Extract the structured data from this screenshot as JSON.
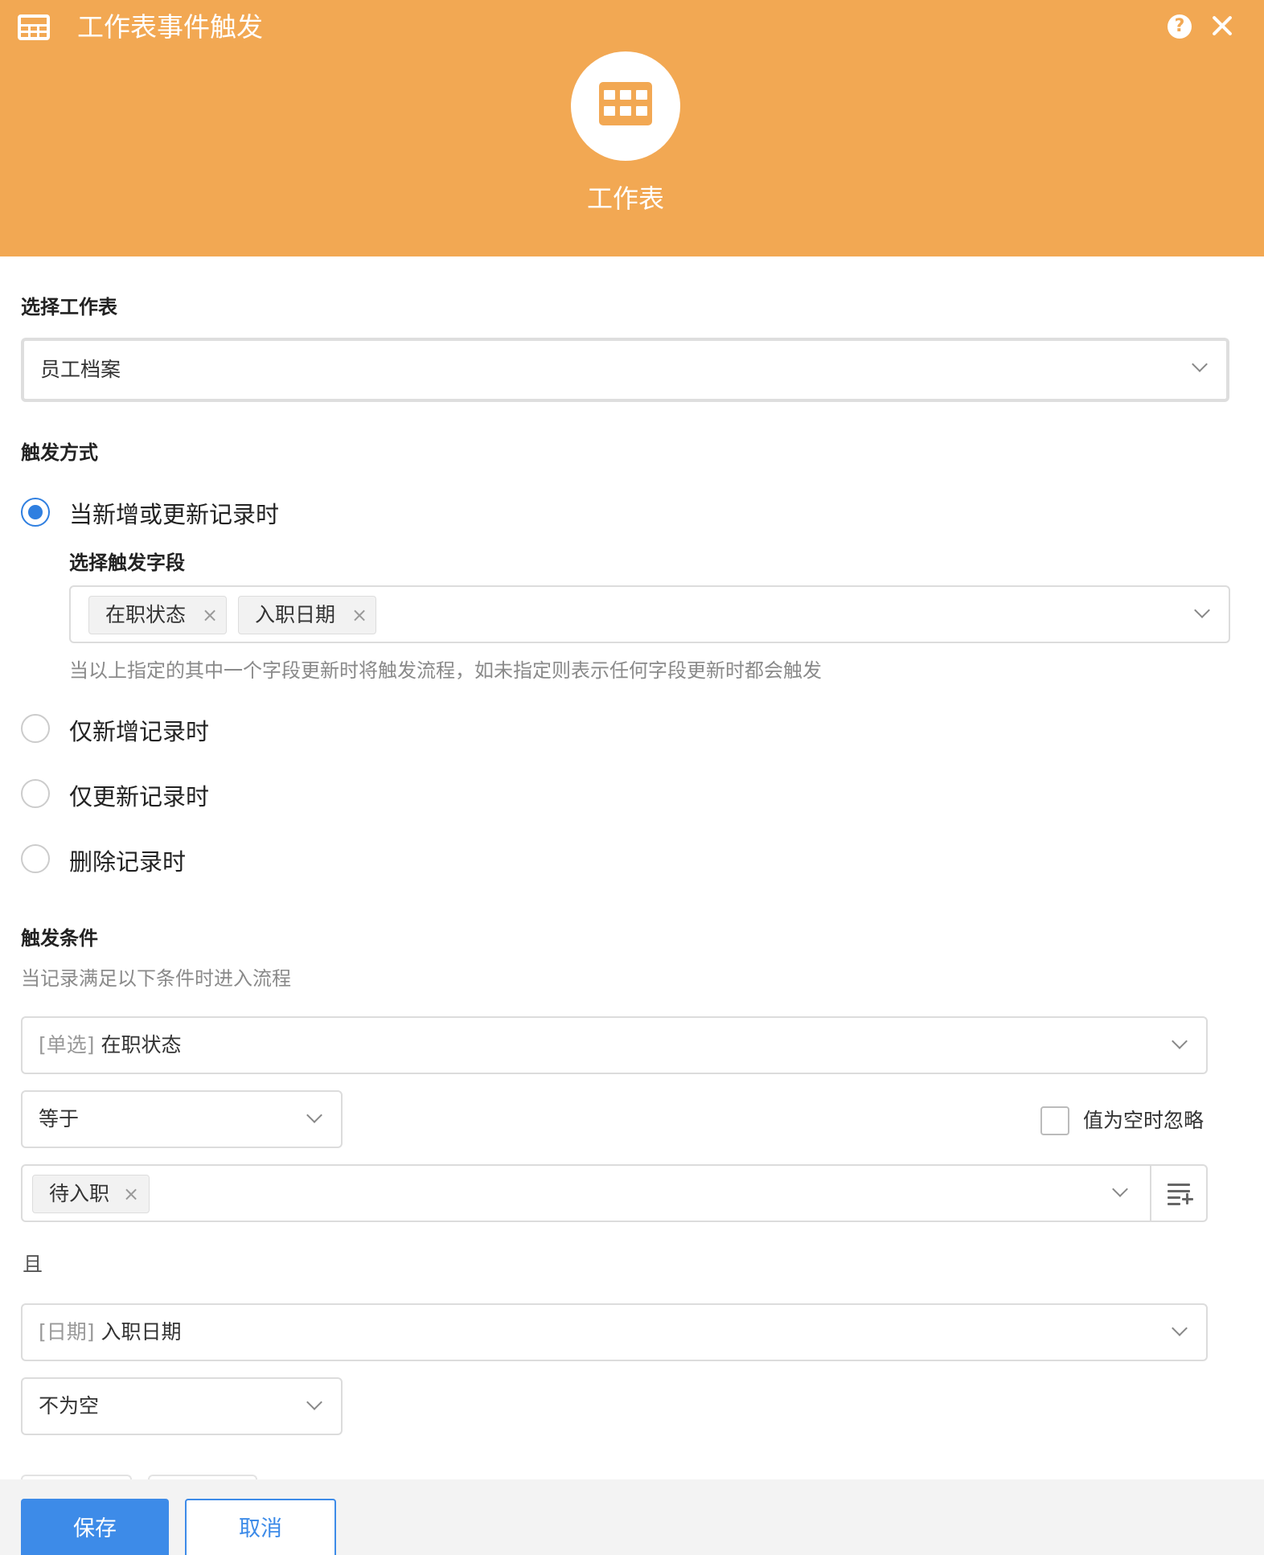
{
  "header": {
    "title": "工作表事件触发",
    "icon": "grid-table-icon",
    "help_symbol": "?",
    "center_label": "工作表",
    "accent_color": "#f2a853"
  },
  "sheet_section": {
    "label": "选择工作表",
    "selected_sheet": "员工档案"
  },
  "trigger_section": {
    "label": "触发方式",
    "options": [
      {
        "label": "当新增或更新记录时",
        "checked": true
      },
      {
        "label": "仅新增记录时",
        "checked": false
      },
      {
        "label": "仅更新记录时",
        "checked": false
      },
      {
        "label": "删除记录时",
        "checked": false
      }
    ],
    "field_select": {
      "label": "选择触发字段",
      "tags": [
        "在职状态",
        "入职日期"
      ],
      "remove_symbol": "×",
      "hint": "当以上指定的其中一个字段更新时将触发流程，如未指定则表示任何字段更新时都会触发"
    }
  },
  "condition_section": {
    "label": "触发条件",
    "hint": "当记录满足以下条件时进入流程",
    "conditions": [
      {
        "field_type": "[单选]",
        "field_name": "在职状态",
        "operator": "等于",
        "ignore_empty_label": "值为空时忽略",
        "ignore_empty_checked": false,
        "values": [
          "待入职"
        ]
      },
      {
        "field_type": "[日期]",
        "field_name": "入职日期",
        "operator": "不为空"
      }
    ],
    "joiner": "且"
  },
  "footer": {
    "save_label": "保存",
    "cancel_label": "取消",
    "primary_color": "#3d8be8"
  }
}
